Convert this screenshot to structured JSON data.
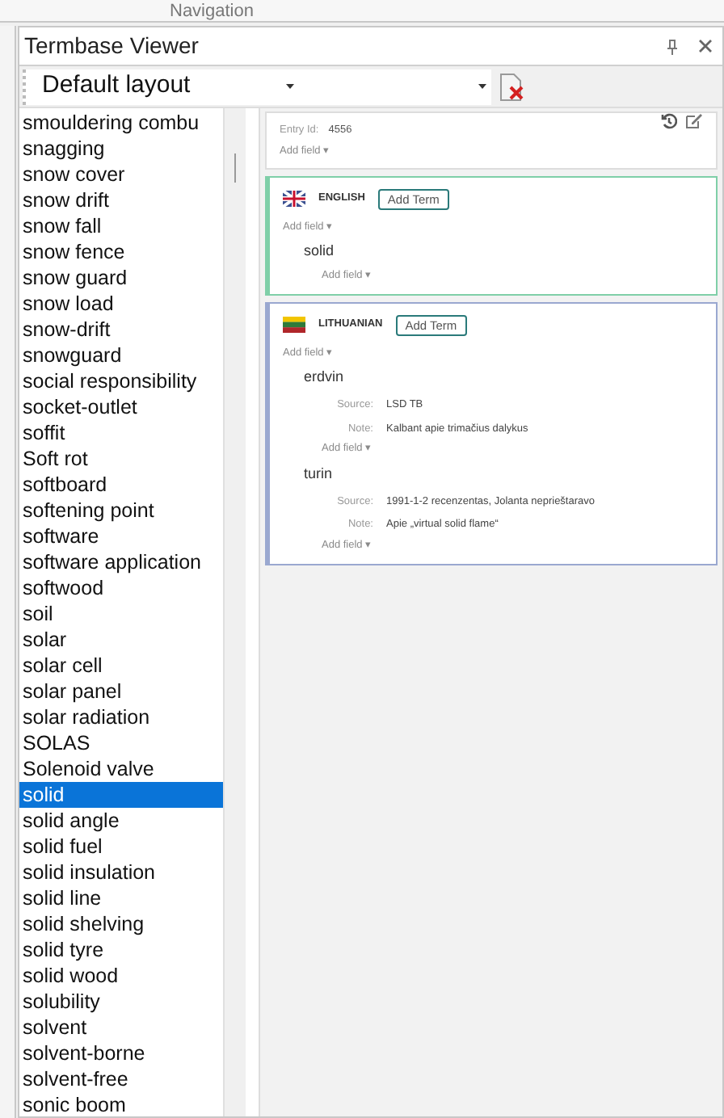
{
  "top_tab": {
    "title": "Navigation"
  },
  "panel": {
    "title": "Termbase Viewer"
  },
  "toolbar": {
    "layout": "Default layout"
  },
  "terms": [
    {
      "text": "smouldering combu",
      "selected": false
    },
    {
      "text": "snagging",
      "selected": false
    },
    {
      "text": "snow cover",
      "selected": false
    },
    {
      "text": "snow drift",
      "selected": false
    },
    {
      "text": "snow fall",
      "selected": false
    },
    {
      "text": "snow fence",
      "selected": false
    },
    {
      "text": "snow guard",
      "selected": false
    },
    {
      "text": "snow load",
      "selected": false
    },
    {
      "text": "snow-drift",
      "selected": false
    },
    {
      "text": "snowguard",
      "selected": false
    },
    {
      "text": "social responsibility",
      "selected": false
    },
    {
      "text": "socket-outlet",
      "selected": false
    },
    {
      "text": "soffit",
      "selected": false
    },
    {
      "text": "Soft rot",
      "selected": false
    },
    {
      "text": "softboard",
      "selected": false
    },
    {
      "text": "softening point",
      "selected": false
    },
    {
      "text": "software",
      "selected": false
    },
    {
      "text": "software application",
      "selected": false
    },
    {
      "text": "softwood",
      "selected": false
    },
    {
      "text": "soil",
      "selected": false
    },
    {
      "text": "solar",
      "selected": false
    },
    {
      "text": "solar cell",
      "selected": false
    },
    {
      "text": "solar panel",
      "selected": false
    },
    {
      "text": "solar radiation",
      "selected": false
    },
    {
      "text": "SOLAS",
      "selected": false
    },
    {
      "text": "Solenoid valve",
      "selected": false
    },
    {
      "text": "solid",
      "selected": true
    },
    {
      "text": "solid angle",
      "selected": false
    },
    {
      "text": "solid fuel",
      "selected": false
    },
    {
      "text": "solid insulation",
      "selected": false
    },
    {
      "text": "solid line",
      "selected": false
    },
    {
      "text": "solid shelving",
      "selected": false
    },
    {
      "text": "solid tyre",
      "selected": false
    },
    {
      "text": "solid wood",
      "selected": false
    },
    {
      "text": "solubility",
      "selected": false
    },
    {
      "text": "solvent",
      "selected": false
    },
    {
      "text": "solvent-borne",
      "selected": false
    },
    {
      "text": "solvent-free",
      "selected": false
    },
    {
      "text": "sonic boom",
      "selected": false
    }
  ],
  "entry": {
    "id_label": "Entry Id:",
    "id": "4556",
    "add_field": "Add field ▾"
  },
  "languages": [
    {
      "name": "ENGLISH",
      "kind": "uk",
      "color": "#7fcfa8",
      "add_term": "Add Term",
      "add_field": "Add field ▾",
      "terms": [
        {
          "term": "solid",
          "add_field": "Add field ▾"
        }
      ]
    },
    {
      "name": "LITHUANIAN",
      "kind": "lt",
      "color": "#9aa8d0",
      "add_term": "Add Term",
      "add_field": "Add field ▾",
      "terms": [
        {
          "term": "erdvin",
          "fields": [
            {
              "label": "Source:",
              "value": "LSD TB"
            },
            {
              "label": "Note:",
              "value": "Kalbant apie trimačius dalykus"
            }
          ],
          "add_field": "Add field ▾"
        },
        {
          "term": "turin",
          "fields": [
            {
              "label": "Source:",
              "value": "1991-1-2 recenzentas, Jolanta neprieštaravo"
            },
            {
              "label": "Note:",
              "value": "Apie „virtual solid flame“"
            }
          ],
          "add_field": "Add field ▾"
        }
      ]
    }
  ]
}
